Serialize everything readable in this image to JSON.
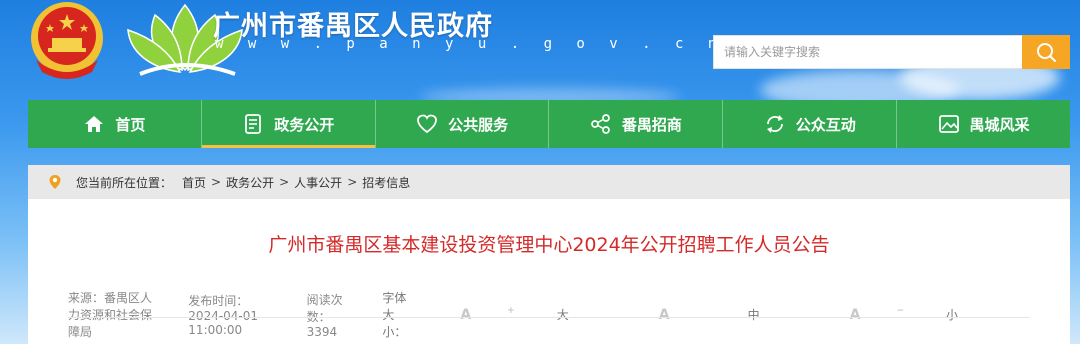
{
  "header": {
    "site_title": "广州市番禺区人民政府",
    "site_url": "w w w . p a n y u . g o v . c n",
    "search_placeholder": "请输入关键字搜索"
  },
  "nav": {
    "items": [
      {
        "label": "首页",
        "icon": "home-icon"
      },
      {
        "label": "政务公开",
        "icon": "document-icon",
        "active": true
      },
      {
        "label": "公共服务",
        "icon": "heart-icon"
      },
      {
        "label": "番禺招商",
        "icon": "share-icon"
      },
      {
        "label": "公众互动",
        "icon": "refresh-icon"
      },
      {
        "label": "禺城风采",
        "icon": "image-icon"
      }
    ]
  },
  "breadcrumb": {
    "label": "您当前所在位置：",
    "items": [
      "首页",
      "政务公开",
      "人事公开",
      "招考信息"
    ],
    "separator": ">"
  },
  "article": {
    "title": "广州市番禺区基本建设投资管理中心2024年公开招聘工作人员公告",
    "source": "来源：番禺区人力资源和社会保障局",
    "published": "发布时间：2024-04-01 11:00:00",
    "views": "阅读次数：3394",
    "font_size_label": "字体大小：",
    "font_options": [
      {
        "glyph": "A",
        "sup": "+",
        "label": "大"
      },
      {
        "glyph": "A",
        "sup": "",
        "label": "中"
      },
      {
        "glyph": "A",
        "sup": "−",
        "label": "小"
      }
    ]
  },
  "colors": {
    "nav_green": "#2fa84f",
    "search_orange": "#f6a623",
    "title_red": "#d42a2a",
    "active_underline": "#f6c143"
  }
}
